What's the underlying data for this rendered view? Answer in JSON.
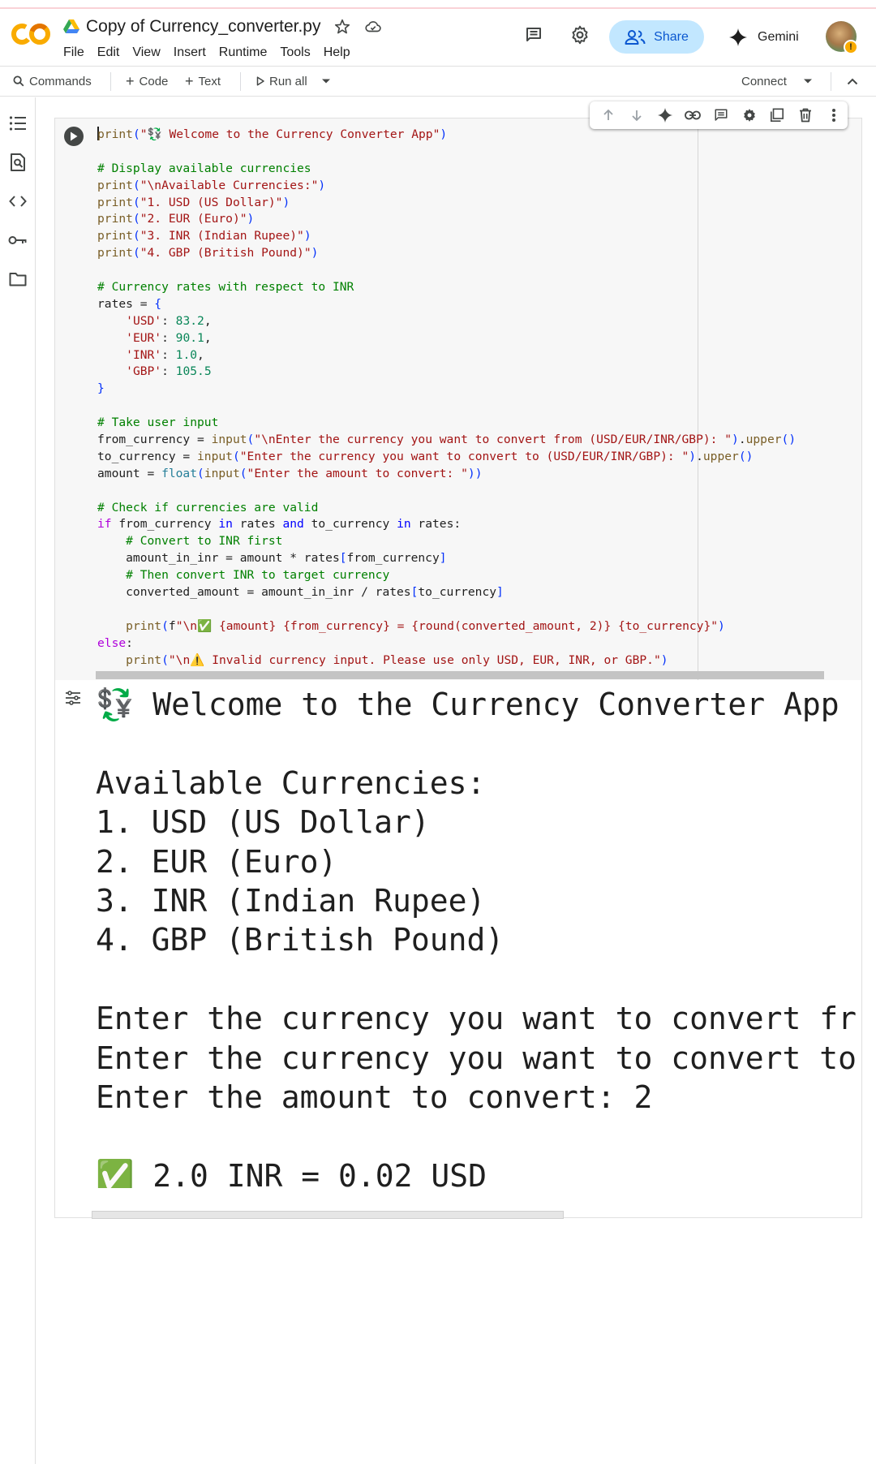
{
  "app": {
    "doc_title": "Copy of Currency_converter.py",
    "menu": [
      "File",
      "Edit",
      "View",
      "Insert",
      "Runtime",
      "Tools",
      "Help"
    ],
    "share_label": "Share",
    "gemini_label": "Gemini",
    "logo_text": "CO"
  },
  "toolbar": {
    "commands_label": "Commands",
    "code_label": "Code",
    "text_label": "Text",
    "run_all_label": "Run all",
    "connect_label": "Connect"
  },
  "code_lines": [
    "print(\"💱 Welcome to the Currency Converter App\")",
    "",
    "# Display available currencies",
    "print(\"\\nAvailable Currencies:\")",
    "print(\"1. USD (US Dollar)\")",
    "print(\"2. EUR (Euro)\")",
    "print(\"3. INR (Indian Rupee)\")",
    "print(\"4. GBP (British Pound)\")",
    "",
    "# Currency rates with respect to INR",
    "rates = {",
    "    'USD': 83.2,",
    "    'EUR': 90.1,",
    "    'INR': 1.0,",
    "    'GBP': 105.5",
    "}",
    "",
    "# Take user input",
    "from_currency = input(\"\\nEnter the currency you want to convert from (USD/EUR/INR/GBP): \").upper()",
    "to_currency = input(\"Enter the currency you want to convert to (USD/EUR/INR/GBP): \").upper()",
    "amount = float(input(\"Enter the amount to convert: \"))",
    "",
    "# Check if currencies are valid",
    "if from_currency in rates and to_currency in rates:",
    "    # Convert to INR first",
    "    amount_in_inr = amount * rates[from_currency]",
    "    # Then convert INR to target currency",
    "    converted_amount = amount_in_inr / rates[to_currency]",
    "",
    "    print(f\"\\n✅ {amount} {from_currency} = {round(converted_amount, 2)} {to_currency}\")",
    "else:",
    "    print(\"\\n⚠️ Invalid currency input. Please use only USD, EUR, INR, or GBP.\")"
  ],
  "output_lines": [
    "💱 Welcome to the Currency Converter App",
    "",
    "Available Currencies:",
    "1. USD (US Dollar)",
    "2. EUR (Euro)",
    "3. INR (Indian Rupee)",
    "4. GBP (British Pound)",
    "",
    "Enter the currency you want to convert fr",
    "Enter the currency you want to convert to",
    "Enter the amount to convert: 2",
    "",
    "✅ 2.0 INR = 0.02 USD"
  ],
  "icons": {
    "header": [
      "drive-icon",
      "star-icon",
      "cloud-icon",
      "comment-icon",
      "settings-icon",
      "people-icon",
      "gemini-sparkle-icon",
      "avatar"
    ],
    "rail": [
      "toc-icon",
      "find-icon",
      "code-snippets-icon",
      "secrets-key-icon",
      "folder-icon"
    ],
    "cell_toolbar": [
      "move-up-icon",
      "move-down-icon",
      "gemini-icon",
      "link-icon",
      "comment-icon",
      "settings-icon",
      "mirror-cell-icon",
      "delete-icon",
      "more-icon"
    ]
  },
  "colors": {
    "accent": "#0b57d0",
    "share_bg": "#c2e7ff",
    "logo_orange": "#f9ab00",
    "string": "#a31515",
    "comment": "#008000"
  }
}
